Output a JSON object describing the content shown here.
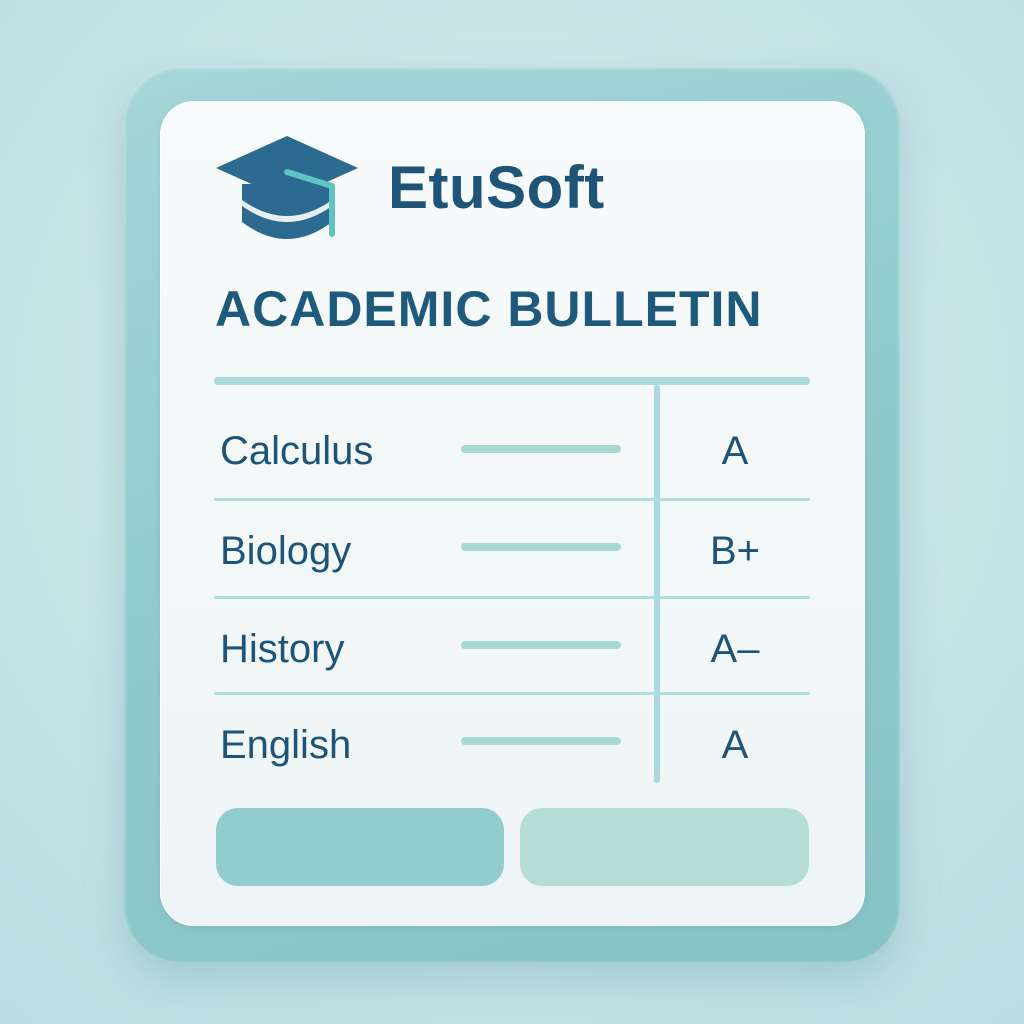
{
  "app": {
    "brand": "EtuSoft",
    "logo_icon": "graduation-cap-icon"
  },
  "bulletin": {
    "title": "ACADEMIC BULLETIN",
    "rows": [
      {
        "subject": "Calculus",
        "grade": "A"
      },
      {
        "subject": "Biology",
        "grade": "B+"
      },
      {
        "subject": "History",
        "grade": "A–"
      },
      {
        "subject": "English",
        "grade": "A"
      }
    ]
  },
  "actions": {
    "primary_label": "",
    "secondary_label": ""
  },
  "colors": {
    "brand_text": "#1d5478",
    "frame": "#8fcacd",
    "accent_line": "#a9d9d9",
    "primary_button": "#93cccf",
    "secondary_button": "#b5ddd6"
  }
}
